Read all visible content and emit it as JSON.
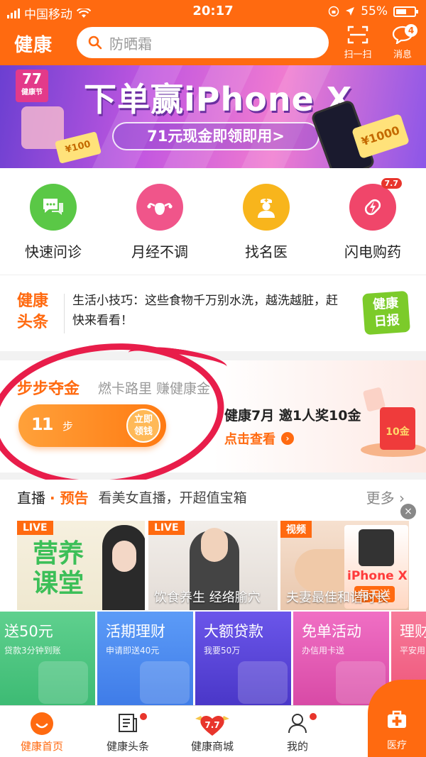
{
  "status_bar": {
    "carrier": "中国移动",
    "time": "20:17",
    "battery": "55%"
  },
  "header": {
    "brand": "健康",
    "search_placeholder": "防晒霜",
    "scan_label": "扫一扫",
    "message_label": "消息",
    "message_count": "4"
  },
  "banner": {
    "badge_number": "77",
    "badge_text": "健康节",
    "title": "下单赢iPhone X",
    "cta": "71元现金即领即用>",
    "coupon_left": "¥100",
    "coupon_right": "¥1000"
  },
  "quick_actions": [
    {
      "label": "快速问诊",
      "icon": "chat-icon",
      "color": "#5ac846"
    },
    {
      "label": "月经不调",
      "icon": "uterus-icon",
      "color": "#f0558a"
    },
    {
      "label": "找名医",
      "icon": "doctor-icon",
      "color": "#f8b51c"
    },
    {
      "label": "闪电购药",
      "icon": "lightning-pill-icon",
      "color": "#f0466a",
      "tag": "7.7"
    }
  ],
  "headline": {
    "logo_line1": "健康",
    "logo_line2": "头条",
    "text": "生活小技巧：这些食物千万别水洗，越洗越脏，赶快来看看！",
    "daily_line1": "健康",
    "daily_line2": "日报"
  },
  "gold": {
    "title": "步步夺金",
    "subtitle": "燃卡路里 赚健康金",
    "steps": "11",
    "step_unit": "步",
    "claim_line1": "立即",
    "claim_line2": "领钱",
    "invite": "健康7月 邀1人奖10金",
    "check": "点击查看",
    "reward": "10金"
  },
  "live": {
    "title": "直播",
    "preview": "预告",
    "desc": "看美女直播，开超值宝箱",
    "more": "更多",
    "cards": [
      {
        "tag": "LIVE",
        "big1": "营养",
        "big2": "课堂",
        "caption": ""
      },
      {
        "tag": "LIVE",
        "caption": "饮食养生 经络腧穴"
      },
      {
        "tag": "视频",
        "caption": "夫妻最佳和谐时长",
        "ad_title": "iPhone X",
        "ad_badge": "每天送"
      }
    ]
  },
  "finance": [
    {
      "title": "送50元",
      "sub": "贷款3分钟到账"
    },
    {
      "title": "活期理财",
      "sub": "申请即送40元"
    },
    {
      "title": "大额贷款",
      "sub": "我要50万"
    },
    {
      "title": "免单活动",
      "sub": "办信用卡送"
    },
    {
      "title": "理财",
      "sub": "平安用"
    }
  ],
  "tabbar": {
    "home": "健康首页",
    "news": "健康头条",
    "mall": "健康商城",
    "mall_badge": "7.7",
    "mine": "我的",
    "clinic": "医疗"
  }
}
